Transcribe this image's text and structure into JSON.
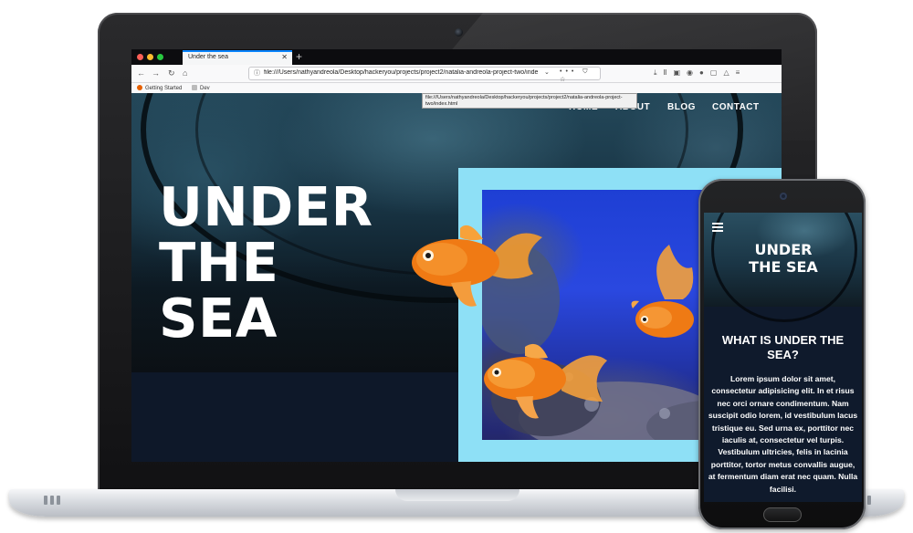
{
  "browser": {
    "tab_title": "Under the sea",
    "tab_close": "✕",
    "new_tab": "+",
    "url": "file:///Users/nathyandreola/Desktop/hackeryou/projects/project2/natalia-andreola-project-two/index.html",
    "url_tooltip": "file:///Users/nathyandreola/Desktop/hackeryou/projects/project2/natalia-andreola-project-two/index.html",
    "url_actions": "••• ⛉ ☆",
    "bookmarks": [
      {
        "label": "Getting Started",
        "icon": "firefox-icon",
        "color": "#e66000"
      },
      {
        "label": "Dev",
        "icon": "folder-icon",
        "color": "#bbbbbb"
      }
    ]
  },
  "site": {
    "nav": [
      "HOME",
      "ABOUT",
      "BLOG",
      "CONTACT"
    ],
    "hero_title": [
      "UNDER",
      "THE",
      "SEA"
    ]
  },
  "phone": {
    "title": [
      "UNDER",
      "THE SEA"
    ],
    "heading": "WHAT IS UNDER THE SEA?",
    "body": "Lorem ipsum dolor sit amet, consectetur adipisicing elit. In et risus nec orci ornare condimentum. Nam suscipit odio lorem, id vestibulum lacus tristique eu. Sed urna ex, porttitor nec iaculis at, consectetur vel turpis. Vestibulum ultricies, felis in lacinia porttitor, tortor metus convallis augue, at fermentum diam erat nec quam. Nulla facilisi."
  },
  "colors": {
    "accent_frame": "#8ee0f6",
    "page_dark": "#0e1829",
    "tab_highlight": "#0a84ff"
  }
}
